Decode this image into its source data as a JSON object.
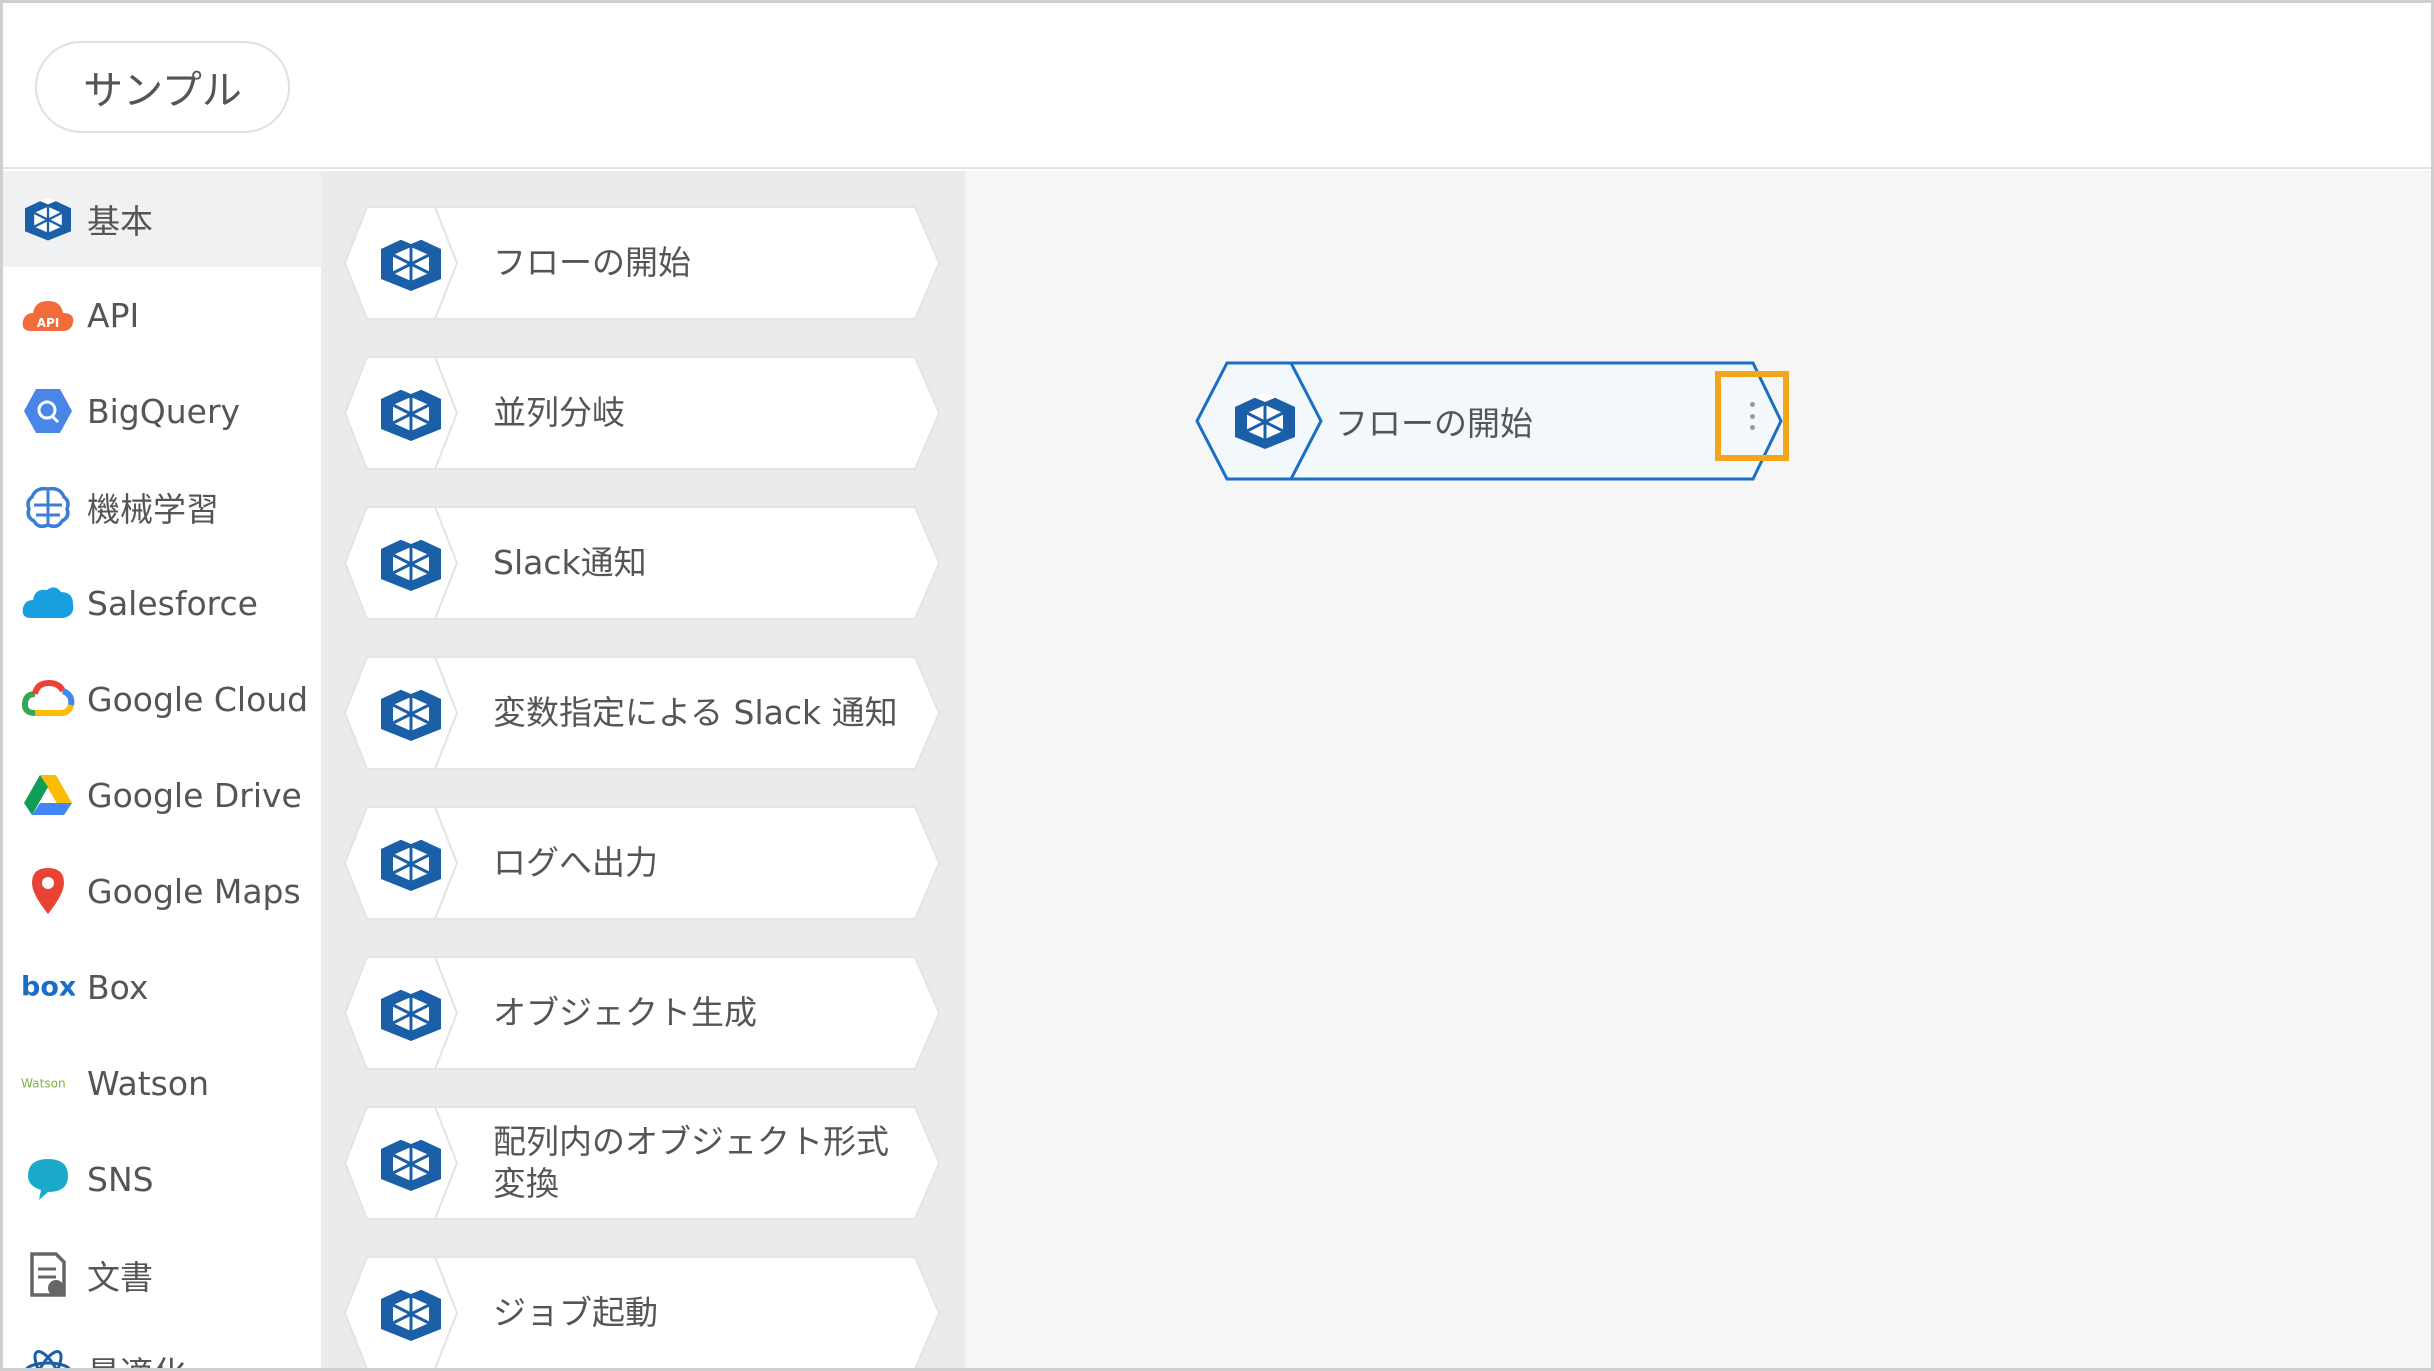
{
  "header": {
    "title": "サンプル"
  },
  "sidebar": {
    "items": [
      {
        "label": "基本",
        "icon": "cube-icon",
        "active": true
      },
      {
        "label": "API",
        "icon": "api-cloud-icon"
      },
      {
        "label": "BigQuery",
        "icon": "bigquery-icon"
      },
      {
        "label": "機械学習",
        "icon": "brain-icon"
      },
      {
        "label": "Salesforce",
        "icon": "salesforce-cloud-icon"
      },
      {
        "label": "Google Cloud",
        "icon": "google-cloud-icon"
      },
      {
        "label": "Google Drive",
        "icon": "google-drive-icon"
      },
      {
        "label": "Google Maps",
        "icon": "map-pin-icon"
      },
      {
        "label": "Box",
        "icon": "box-logo-icon"
      },
      {
        "label": "Watson",
        "icon": "watson-logo-icon"
      },
      {
        "label": "SNS",
        "icon": "chat-bubble-icon"
      },
      {
        "label": "文書",
        "icon": "document-icon"
      },
      {
        "label": "最適化",
        "icon": "atom-icon"
      }
    ]
  },
  "palette": {
    "blocks": [
      {
        "label": "フローの開始"
      },
      {
        "label": "並列分岐"
      },
      {
        "label": "Slack通知"
      },
      {
        "label": "変数指定による Slack 通知"
      },
      {
        "label": "ログへ出力"
      },
      {
        "label": "オブジェクト生成"
      },
      {
        "label": "配列内のオブジェクト形式変換"
      },
      {
        "label": "ジョブ起動"
      }
    ]
  },
  "canvas": {
    "node": {
      "label": "フローの開始",
      "menu_icon": "kebab-menu-icon"
    }
  },
  "colors": {
    "brand_blue": "#1a5fa8",
    "highlight": "#f3a51b"
  }
}
